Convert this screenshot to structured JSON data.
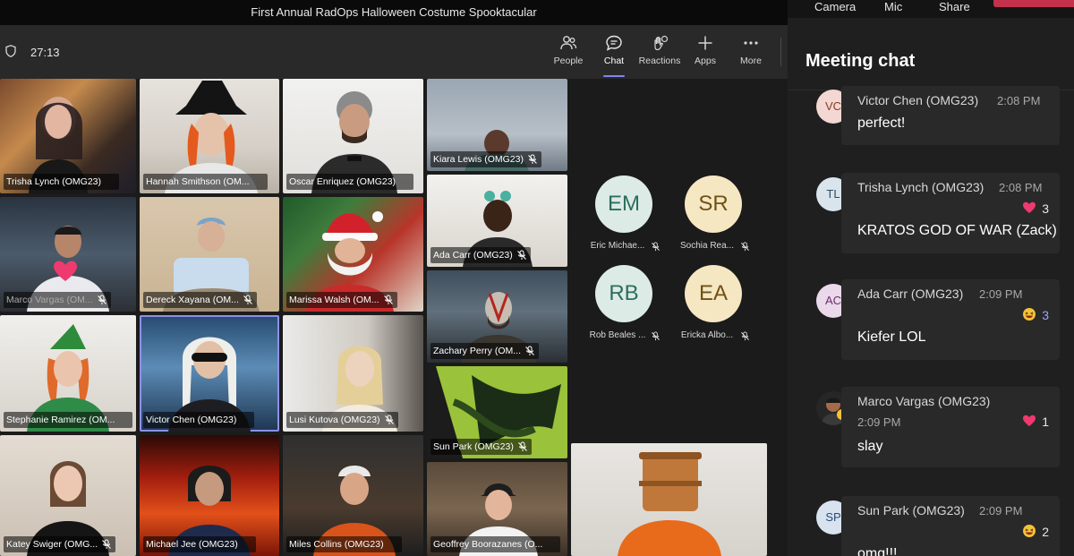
{
  "window": {
    "title": "First Annual RadOps Halloween Costume Spooktacular"
  },
  "toolbar": {
    "timer": "27:13",
    "buttons": [
      {
        "label": "People",
        "icon": "people-icon"
      },
      {
        "label": "Chat",
        "icon": "chat-icon",
        "active": true
      },
      {
        "label": "Reactions",
        "icon": "reactions-icon"
      },
      {
        "label": "Apps",
        "icon": "plus-icon"
      },
      {
        "label": "More",
        "icon": "more-icon"
      }
    ]
  },
  "panel_tabs": [
    "Camera",
    "Mic",
    "Share"
  ],
  "participants": [
    {
      "name": "Trisha Lynch (OMG23)"
    },
    {
      "name": "Hannah Smithson (OMG23)"
    },
    {
      "name": "Oscar Enriquez (OMG23)"
    },
    {
      "name": "Kiara Lewis (OMG23)"
    },
    {
      "name": "Ada Carr (OMG23)"
    },
    {
      "name": "Marco Vargas (OMG23)"
    },
    {
      "name": "Dereck Xayana (OMG23)"
    },
    {
      "name": "Marissa Walsh (OMG23)"
    },
    {
      "name": "Zachary Perry (OMG23)"
    },
    {
      "name": "Stephanie Ramirez (OMG23)"
    },
    {
      "name": "Victor Chen (OMG23)"
    },
    {
      "name": "Lusi Kutova (OMG23)"
    },
    {
      "name": "Sun Park (OMG23)"
    },
    {
      "name": "Katey Swiger (OMG23)"
    },
    {
      "name": "Michael Jee (OMG23)"
    },
    {
      "name": "Miles Collins (OMG23)"
    },
    {
      "name": "Geoffrey Boorazanes (OMG23)"
    }
  ],
  "tile_labels": {
    "trisha": "Trisha Lynch (OMG23)",
    "hannah": "Hannah Smithson (OM...",
    "oscar": "Oscar Enriquez (OMG23)",
    "kiara": "Kiara Lewis (OMG23)",
    "ada": "Ada Carr (OMG23)",
    "marco": "Marco Vargas (OM...",
    "dereck": "Dereck Xayana (OM...",
    "marissa": "Marissa Walsh (OM...",
    "zachary": "Zachary Perry (OM...",
    "stephanie": "Stephanie Ramirez (OM...",
    "victor": "Victor Chen (OMG23)",
    "lusi": "Lusi Kutova (OMG23)",
    "sun": "Sun Park (OMG23)",
    "katey": "Katey Swiger (OMG...",
    "michael": "Michael Jee (OMG23)",
    "miles": "Miles Collins (OMG23)",
    "geoffrey": "Geoffrey Boorazanes (O..."
  },
  "audio_only": [
    {
      "initials": "EM",
      "label": "Eric Michae...",
      "color": "teal"
    },
    {
      "initials": "SR",
      "label": "Sochia Rea...",
      "color": "gold"
    },
    {
      "initials": "RB",
      "label": "Rob Beales ...",
      "color": "teal"
    },
    {
      "initials": "EA",
      "label": "Ericka Albo...",
      "color": "gold"
    }
  ],
  "chat": {
    "title": "Meeting chat",
    "messages": [
      {
        "initials": "VC",
        "sender": "Victor Chen (OMG23)",
        "time": "2:08 PM",
        "text": "perfect!"
      },
      {
        "initials": "TL",
        "sender": "Trisha Lynch (OMG23)",
        "time": "2:08 PM",
        "text": "KRATOS GOD OF WAR (Zack)",
        "reaction": "heart",
        "count": "3"
      },
      {
        "initials": "AC",
        "sender": "Ada Carr (OMG23)",
        "time": "2:09 PM",
        "text": "Kiefer LOL",
        "reaction": "laugh",
        "count": "3"
      },
      {
        "initials": "",
        "sender": "Marco Vargas (OMG23)",
        "time": "2:09 PM",
        "text": "slay",
        "reaction": "heart",
        "count": "1"
      },
      {
        "initials": "SP",
        "sender": "Sun Park (OMG23)",
        "time": "2:09 PM",
        "text": "omg!!!",
        "reaction": "laugh",
        "count": "2"
      }
    ]
  },
  "colors": {
    "accent": "#7f85f5",
    "leave": "#c4314b",
    "selected_outline": "#8e90e8"
  }
}
